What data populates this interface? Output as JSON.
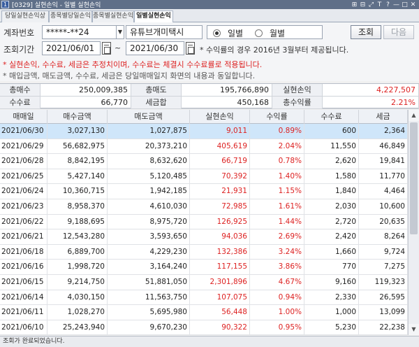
{
  "window": {
    "title": "[0329] 실현손익 - 일별 실현손익",
    "app_icon_text": "1",
    "controls": [
      "⊞",
      "⊟",
      "⤢",
      "T",
      "?",
      "—",
      "□",
      "✕"
    ]
  },
  "tabs": [
    {
      "label": "당일실현손익상세"
    },
    {
      "label": "종목별당일손익"
    },
    {
      "label": "종목별실현손익"
    },
    {
      "label": "일별실현손익"
    }
  ],
  "form": {
    "account_label": "계좌번호",
    "account_value": "*****-**24",
    "account_name": "유튜브개미택시",
    "radio_daily": "일별",
    "radio_monthly": "월별",
    "query_button": "조회",
    "next_button": "다음",
    "period_label": "조회기간",
    "date_from": "2021/06/01",
    "date_tilde": "~",
    "date_to": "2021/06/30",
    "note_return": "* 수익률의 경우 2016년 3월부터 제공됩니다.",
    "note_red": "* 실현손익, 수수료, 세금은 추정치이며, 수수료는 체결시 수수료률로 적용됩니다.",
    "note_gray": "* 매입금액, 매도금액, 수수료, 세금은 당일매매일지 화면의 내용과 동일합니다."
  },
  "summary": {
    "total_buy_label": "총매수",
    "total_buy": "250,009,385",
    "total_sell_label": "총매도",
    "total_sell": "195,766,890",
    "realized_label": "실현손익",
    "realized": "4,227,507",
    "fee_label": "수수료",
    "fee": "66,770",
    "tax_label": "세금합",
    "tax": "450,168",
    "return_label": "총수익률",
    "return": "2.21%"
  },
  "table": {
    "headers": [
      "매매일",
      "매수금액",
      "매도금액",
      "실현손익",
      "수익률",
      "수수료",
      "세금"
    ],
    "rows": [
      [
        "2021/06/30",
        "3,027,130",
        "1,027,875",
        "9,011",
        "0.89%",
        "600",
        "2,364"
      ],
      [
        "2021/06/29",
        "56,682,975",
        "20,373,210",
        "405,619",
        "2.04%",
        "11,550",
        "46,849"
      ],
      [
        "2021/06/28",
        "8,842,195",
        "8,632,620",
        "66,719",
        "0.78%",
        "2,620",
        "19,841"
      ],
      [
        "2021/06/25",
        "5,427,140",
        "5,120,485",
        "70,392",
        "1.40%",
        "1,580",
        "11,770"
      ],
      [
        "2021/06/24",
        "10,360,715",
        "1,942,185",
        "21,931",
        "1.15%",
        "1,840",
        "4,464"
      ],
      [
        "2021/06/23",
        "8,958,370",
        "4,610,030",
        "72,985",
        "1.61%",
        "2,030",
        "10,600"
      ],
      [
        "2021/06/22",
        "9,188,695",
        "8,975,720",
        "126,925",
        "1.44%",
        "2,720",
        "20,635"
      ],
      [
        "2021/06/21",
        "12,543,280",
        "3,593,650",
        "94,036",
        "2.69%",
        "2,420",
        "8,264"
      ],
      [
        "2021/06/18",
        "6,889,700",
        "4,229,230",
        "132,386",
        "3.24%",
        "1,660",
        "9,724"
      ],
      [
        "2021/06/16",
        "1,998,720",
        "3,164,240",
        "117,155",
        "3.86%",
        "770",
        "7,275"
      ],
      [
        "2021/06/15",
        "9,214,750",
        "51,881,050",
        "2,301,896",
        "4.67%",
        "9,160",
        "119,323"
      ],
      [
        "2021/06/14",
        "4,030,150",
        "11,563,750",
        "107,075",
        "0.94%",
        "2,330",
        "26,595"
      ],
      [
        "2021/06/11",
        "1,028,270",
        "5,695,980",
        "56,448",
        "1.00%",
        "1,000",
        "13,099"
      ],
      [
        "2021/06/10",
        "25,243,940",
        "9,670,230",
        "90,322",
        "0.95%",
        "5,230",
        "22,238"
      ],
      [
        "2021/06/09",
        "2,030,640",
        "3,102,900",
        "39,978",
        "1.31%",
        "770",
        "7,133"
      ]
    ]
  },
  "status": "조회가 완료되었습니다.",
  "colors": {
    "positive": "#d22222",
    "selected_row": "#cfe6fa",
    "title_bar": "#5f6f88"
  }
}
